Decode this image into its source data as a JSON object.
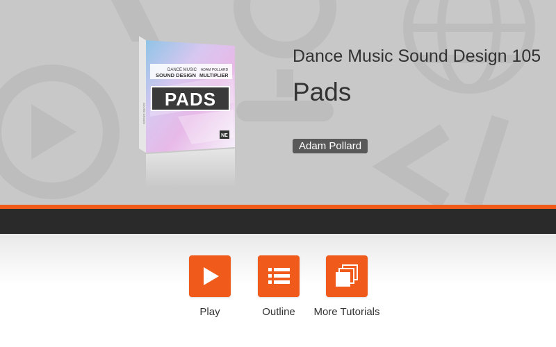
{
  "course": {
    "series_title": "Dance Music Sound Design 105",
    "title": "Pads",
    "author": "Adam Pollard"
  },
  "box_art": {
    "series_line_1": "DANCE MUSIC",
    "series_line_2": "SOUND DESIGN",
    "author_line": "ADAM POLLARD",
    "product_line": "MULTIPLIER",
    "title": "PADS",
    "publisher_logo": "NE",
    "spine_text": "SOUND DESIGN"
  },
  "actions": [
    {
      "label": "Play",
      "icon": "play-icon"
    },
    {
      "label": "Outline",
      "icon": "list-icon"
    },
    {
      "label": "More Tutorials",
      "icon": "stacked-pages-icon"
    }
  ],
  "colors": {
    "accent": "#f05a1a",
    "hero_background": "#c8c8c8",
    "dark_band": "#2a2a2a",
    "badge": "#595959",
    "text": "#333333"
  }
}
